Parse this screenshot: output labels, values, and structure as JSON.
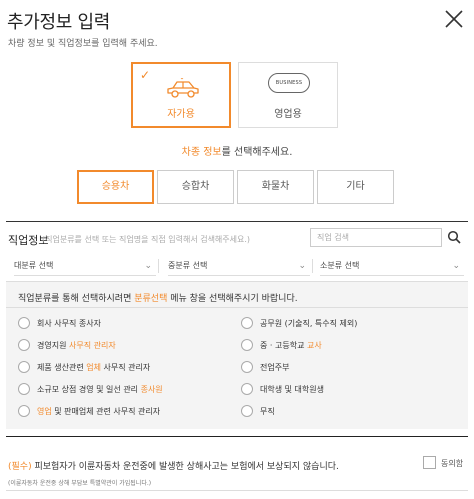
{
  "header": {
    "title": "추가정보 입력",
    "subtitle": "차량 정보 및 직업정보를 입력해 주세요."
  },
  "usage": {
    "private_label": "자가용",
    "business_label": "영업용",
    "business_badge_text": "BUSINESS"
  },
  "car_type": {
    "message_highlight": "차종 정보",
    "message_rest": "를 선택해주세요.",
    "options": [
      "승용차",
      "승합차",
      "화물차",
      "기타"
    ]
  },
  "job": {
    "label": "직업정보",
    "hint": "(직업분류를 선택 또는 직업명을 직접 입력해서 검색해주세요.)",
    "search_placeholder": "직업 검색",
    "dropdowns": [
      "대분류 선택",
      "중분류 선택",
      "소분류 선택"
    ],
    "panel_header_pre": "직업분류를 통해 선택하시려면 ",
    "panel_header_highlight": "분류선택",
    "panel_header_post": " 메뉴 창을 선택해주시기 바랍니다.",
    "left_options": [
      {
        "pre": "회사 사무직 종사자",
        "hl": "",
        "post": ""
      },
      {
        "pre": "경영지원 ",
        "hl": "사무직 관리자",
        "post": ""
      },
      {
        "pre": "제품 생산관련 ",
        "hl": "업체",
        "post": " 사무직 관리자"
      },
      {
        "pre": "소규모 상점 경영 및 일선 관리 ",
        "hl": "종사원",
        "post": ""
      },
      {
        "pre": "",
        "hl": "영업",
        "post": " 및 판매업체 관련 사무직 관리자"
      }
    ],
    "right_options": [
      {
        "pre": "공무원 (기술직, 특수직 제외)",
        "hl": "",
        "post": ""
      },
      {
        "pre": "중 · 고등학교 ",
        "hl": "교사",
        "post": ""
      },
      {
        "pre": "전업주부",
        "hl": "",
        "post": ""
      },
      {
        "pre": "대학생 및 대학원생",
        "hl": "",
        "post": ""
      },
      {
        "pre": "무직",
        "hl": "",
        "post": ""
      }
    ]
  },
  "notice": {
    "required_tag": "(필수)",
    "text": " 피보험자가 이륜자동차 운전중에 발생한 상해사고는 보험에서 보상되지 않습니다.",
    "sub": "(이륜자동차 운전중 상해 부담보 특별약관이 가입됩니다.)",
    "agree_label": "동의함"
  },
  "colors": {
    "accent": "#f28a2c"
  }
}
